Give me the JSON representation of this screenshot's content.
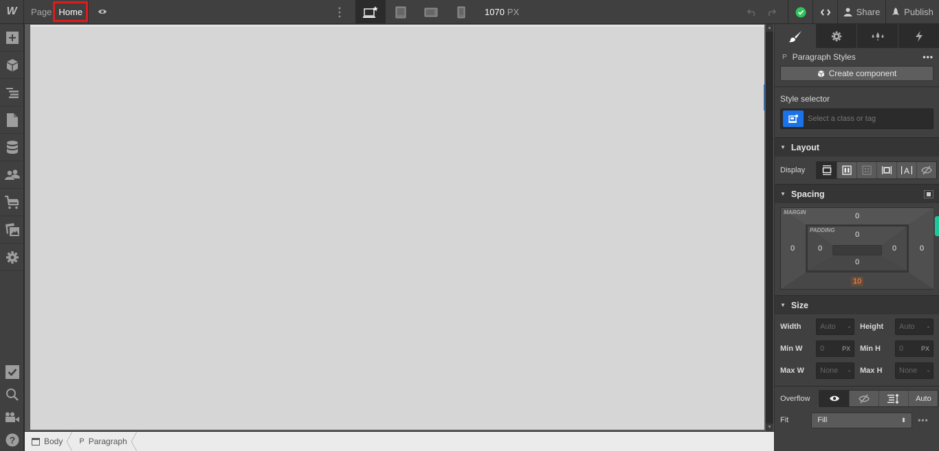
{
  "topbar": {
    "logo": "W",
    "page_label": "Page",
    "page_name": "Home",
    "canvas_width_value": "1070",
    "canvas_width_unit": "PX",
    "share_label": "Share",
    "publish_label": "Publish",
    "devices": [
      "desktop-base",
      "tablet",
      "mobile-landscape",
      "mobile-portrait"
    ]
  },
  "left_sidebar": {
    "top_items": [
      "add",
      "components",
      "navigator",
      "pages",
      "cms",
      "users",
      "ecommerce",
      "assets",
      "settings"
    ],
    "bottom_items": [
      "audit",
      "search",
      "tutorials",
      "help"
    ]
  },
  "breadcrumb": [
    {
      "icon": "body-icon",
      "label": "Body"
    },
    {
      "icon": "P",
      "label": "Paragraph"
    }
  ],
  "right_panel": {
    "tabs": [
      "style",
      "settings",
      "interactions-color",
      "interactions"
    ],
    "element_tag": "P",
    "element_title": "Paragraph Styles",
    "create_component": "Create component",
    "style_selector_label": "Style selector",
    "style_selector_placeholder": "Select a class or tag",
    "layout": {
      "title": "Layout",
      "display_label": "Display",
      "display_options": [
        "block",
        "flex",
        "grid",
        "inline-block",
        "inline",
        "none"
      ],
      "display_active": "block"
    },
    "spacing": {
      "title": "Spacing",
      "margin_label": "MARGIN",
      "padding_label": "PADDING",
      "margin": {
        "top": "0",
        "right": "0",
        "bottom": "10",
        "left": "0"
      },
      "padding": {
        "top": "0",
        "right": "0",
        "bottom": "0",
        "left": "0"
      }
    },
    "size": {
      "title": "Size",
      "width_label": "Width",
      "width_value": "Auto",
      "width_unit": "-",
      "height_label": "Height",
      "height_value": "Auto",
      "height_unit": "-",
      "min_w_label": "Min W",
      "min_w_value": "0",
      "min_w_unit": "PX",
      "min_h_label": "Min H",
      "min_h_value": "0",
      "min_h_unit": "PX",
      "max_w_label": "Max W",
      "max_w_value": "None",
      "max_w_unit": "-",
      "max_h_label": "Max H",
      "max_h_value": "None",
      "max_h_unit": "-",
      "overflow_label": "Overflow",
      "overflow_options": [
        "visible",
        "hidden",
        "scroll",
        "Auto"
      ],
      "overflow_active": "visible",
      "fit_label": "Fit",
      "fit_value": "Fill"
    }
  },
  "colors": {
    "accent_blue": "#1a73e8",
    "status_green": "#2ec45c",
    "highlight_red": "#e01b1b",
    "teal_handle": "#19c99b",
    "margin_orange": "#ff9955"
  }
}
